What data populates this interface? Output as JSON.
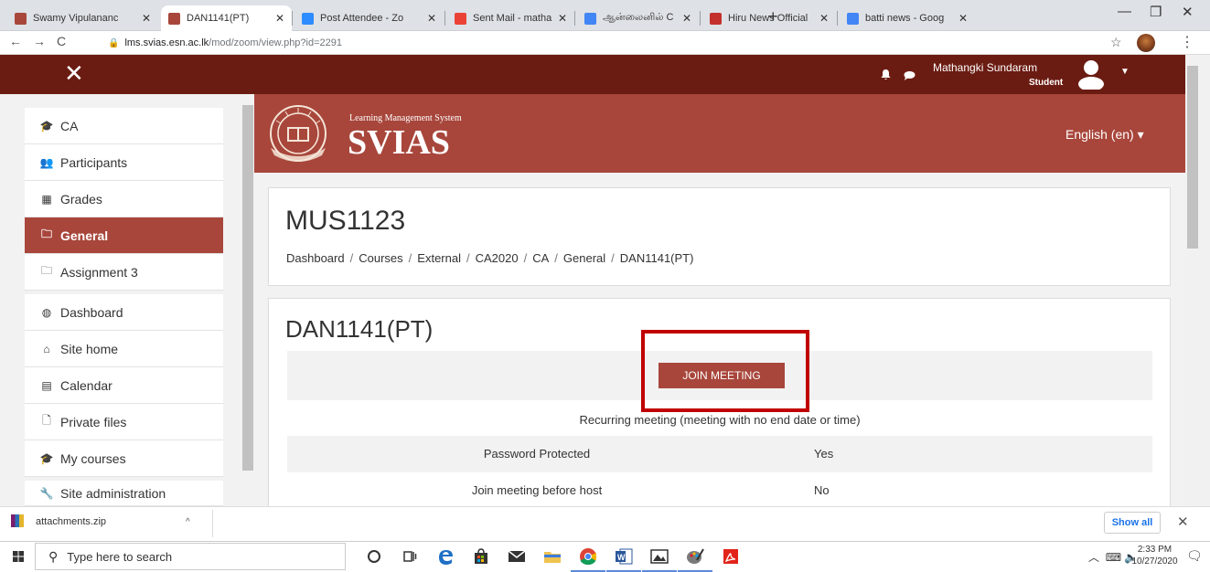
{
  "browser": {
    "tabs": [
      {
        "title": "Swamy Vipulananc",
        "favicon_color": "#a8463b"
      },
      {
        "title": "DAN1141(PT)",
        "favicon_color": "#a8463b"
      },
      {
        "title": "Post Attendee - Zo",
        "favicon_color": "#2d8cff"
      },
      {
        "title": "Sent Mail - mathar",
        "favicon_color": "#ea4335"
      },
      {
        "title": "ஆன்லைனில் C",
        "favicon_color": "#4285f4"
      },
      {
        "title": "Hiru News Official",
        "favicon_color": "#c4302b"
      },
      {
        "title": "batti news - Goog",
        "favicon_color": "#4285f4"
      }
    ],
    "active_tab_index": 1,
    "url_host": "lms.svias.esn.ac.lk",
    "url_path": "/mod/zoom/view.php?id=2291"
  },
  "navbar": {
    "user_name": "Mathangki Sundaram",
    "user_role": "Student",
    "bg_color": "#6b1c12"
  },
  "drawer": {
    "items": [
      {
        "label": "CA",
        "icon": "graduation-cap-icon",
        "glyph": "🎓"
      },
      {
        "label": "Participants",
        "icon": "users-icon",
        "glyph": "👥"
      },
      {
        "label": "Grades",
        "icon": "table-icon",
        "glyph": "▦"
      },
      {
        "label": "General",
        "icon": "folder-icon",
        "glyph": "🗀"
      },
      {
        "label": "Assignment 3",
        "icon": "folder-icon",
        "glyph": "🗀"
      },
      {
        "label": "Dashboard",
        "icon": "dashboard-icon",
        "glyph": "◍"
      },
      {
        "label": "Site home",
        "icon": "home-icon",
        "glyph": "⌂"
      },
      {
        "label": "Calendar",
        "icon": "calendar-icon",
        "glyph": "▤"
      },
      {
        "label": "Private files",
        "icon": "file-icon",
        "glyph": "🗋"
      },
      {
        "label": "My courses",
        "icon": "graduation-cap-icon",
        "glyph": "🎓"
      },
      {
        "label": "Site administration",
        "icon": "wrench-icon",
        "glyph": "🔧"
      }
    ],
    "active_index": 3
  },
  "banner": {
    "logo_small_text": "Learning Management System",
    "logo_big_text": "SVIAS",
    "language": "English (en)",
    "bg_color": "#a8463b"
  },
  "course": {
    "title": "MUS1123",
    "breadcrumb": [
      "Dashboard",
      "Courses",
      "External",
      "CA2020",
      "CA",
      "General",
      "DAN1141(PT)"
    ]
  },
  "meeting": {
    "title": "DAN1141(PT)",
    "join_button": "JOIN MEETING",
    "recurring_text": "Recurring meeting (meeting with no end date or time)",
    "rows": [
      {
        "label": "Password Protected",
        "value": "Yes"
      },
      {
        "label": "Join meeting before host",
        "value": "No"
      }
    ]
  },
  "downloads": {
    "file_name": "attachments.zip",
    "show_all": "Show all"
  },
  "taskbar": {
    "search_placeholder": "Type here to search",
    "time": "2:33 PM",
    "date": "10/27/2020"
  }
}
